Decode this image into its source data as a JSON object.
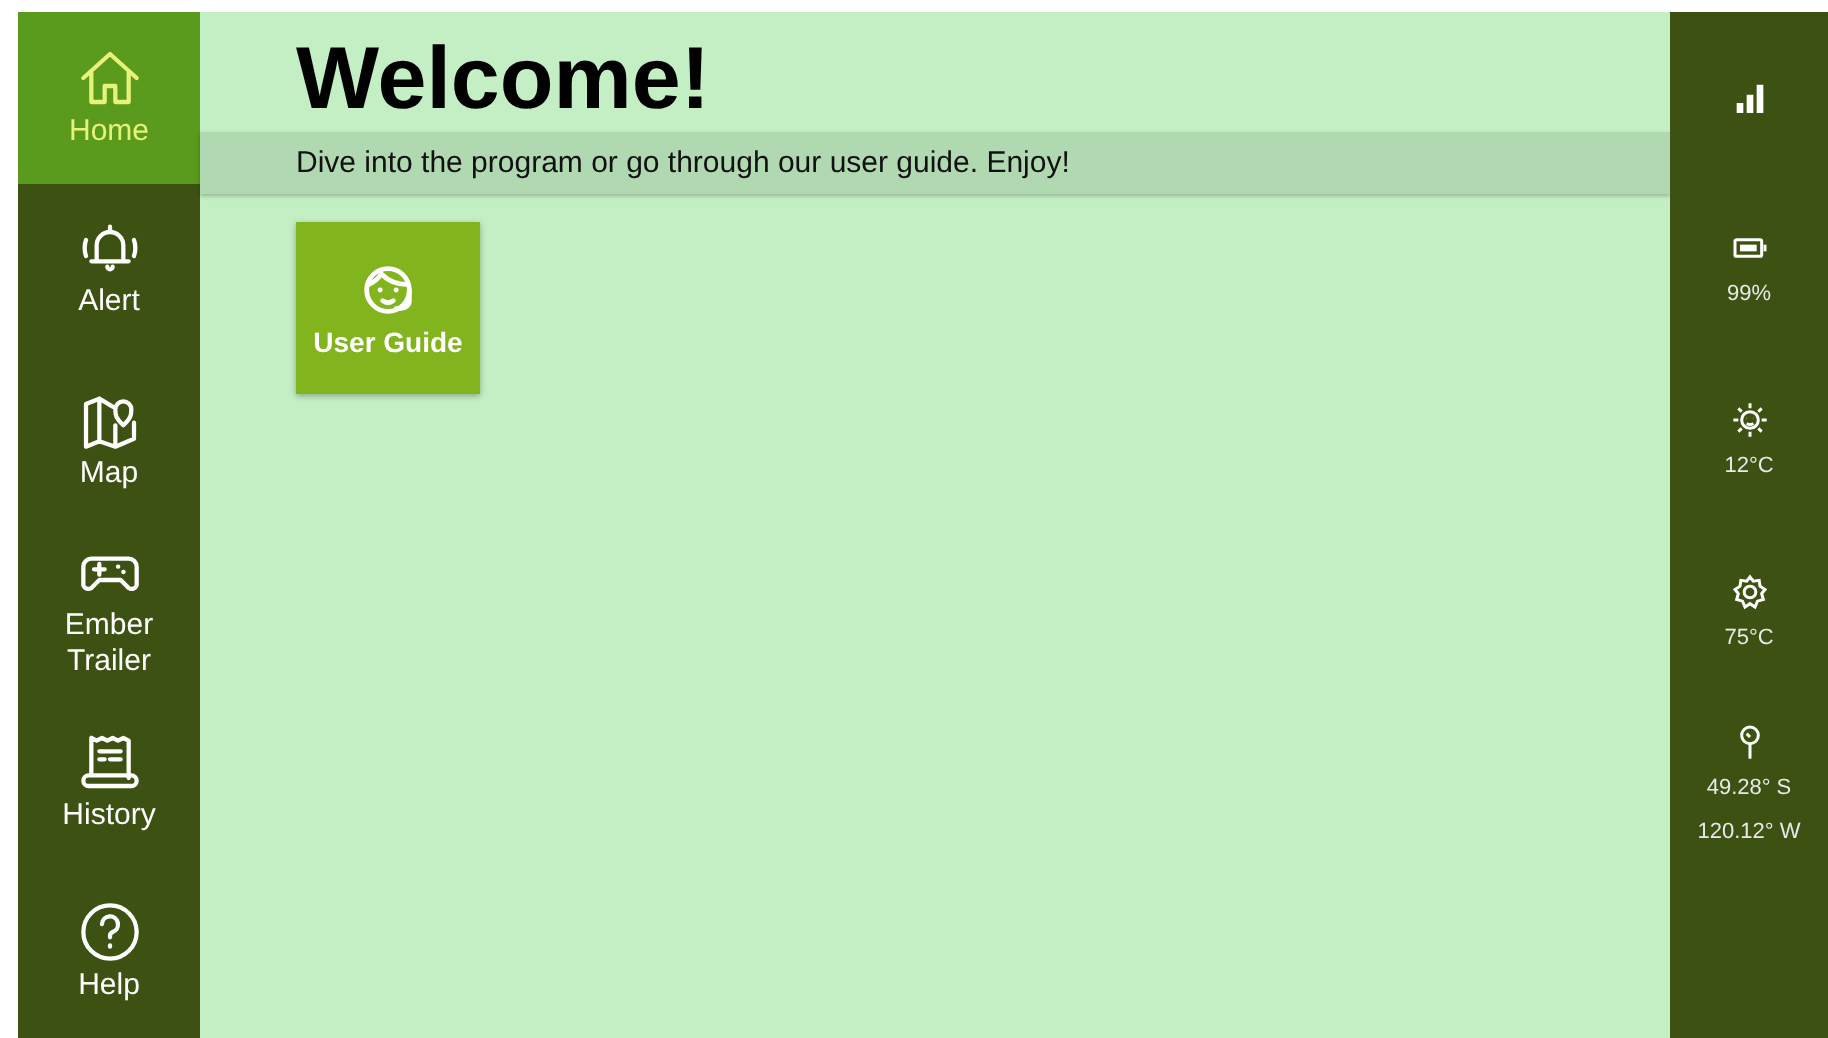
{
  "sidebar": {
    "items": [
      {
        "label": "Home",
        "selected": true
      },
      {
        "label": "Alert",
        "selected": false
      },
      {
        "label": "Map",
        "selected": false
      },
      {
        "label": "Ember Trailer",
        "selected": false
      },
      {
        "label": "History",
        "selected": false
      },
      {
        "label": "Help",
        "selected": false
      }
    ]
  },
  "main": {
    "title": "Welcome!",
    "subtitle": "Dive into the program or go through our user guide. Enjoy!",
    "tiles": [
      {
        "label": "User Guide"
      }
    ]
  },
  "status_panel": {
    "items": [
      {
        "texts": [
          "99%"
        ]
      },
      {
        "texts": [
          "12°C"
        ]
      },
      {
        "texts": [
          "75°C"
        ]
      },
      {
        "texts": [
          "49.28° S",
          "120.12° W"
        ]
      }
    ]
  }
}
